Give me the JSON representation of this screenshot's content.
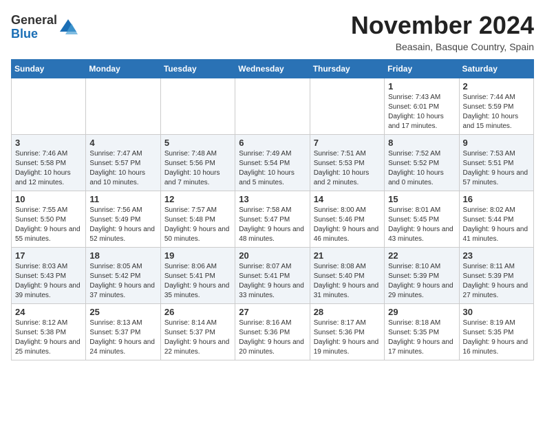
{
  "logo": {
    "line1": "General",
    "line2": "Blue"
  },
  "title": "November 2024",
  "location": "Beasain, Basque Country, Spain",
  "weekdays": [
    "Sunday",
    "Monday",
    "Tuesday",
    "Wednesday",
    "Thursday",
    "Friday",
    "Saturday"
  ],
  "weeks": [
    [
      {
        "day": "",
        "info": ""
      },
      {
        "day": "",
        "info": ""
      },
      {
        "day": "",
        "info": ""
      },
      {
        "day": "",
        "info": ""
      },
      {
        "day": "",
        "info": ""
      },
      {
        "day": "1",
        "info": "Sunrise: 7:43 AM\nSunset: 6:01 PM\nDaylight: 10 hours and 17 minutes."
      },
      {
        "day": "2",
        "info": "Sunrise: 7:44 AM\nSunset: 5:59 PM\nDaylight: 10 hours and 15 minutes."
      }
    ],
    [
      {
        "day": "3",
        "info": "Sunrise: 7:46 AM\nSunset: 5:58 PM\nDaylight: 10 hours and 12 minutes."
      },
      {
        "day": "4",
        "info": "Sunrise: 7:47 AM\nSunset: 5:57 PM\nDaylight: 10 hours and 10 minutes."
      },
      {
        "day": "5",
        "info": "Sunrise: 7:48 AM\nSunset: 5:56 PM\nDaylight: 10 hours and 7 minutes."
      },
      {
        "day": "6",
        "info": "Sunrise: 7:49 AM\nSunset: 5:54 PM\nDaylight: 10 hours and 5 minutes."
      },
      {
        "day": "7",
        "info": "Sunrise: 7:51 AM\nSunset: 5:53 PM\nDaylight: 10 hours and 2 minutes."
      },
      {
        "day": "8",
        "info": "Sunrise: 7:52 AM\nSunset: 5:52 PM\nDaylight: 10 hours and 0 minutes."
      },
      {
        "day": "9",
        "info": "Sunrise: 7:53 AM\nSunset: 5:51 PM\nDaylight: 9 hours and 57 minutes."
      }
    ],
    [
      {
        "day": "10",
        "info": "Sunrise: 7:55 AM\nSunset: 5:50 PM\nDaylight: 9 hours and 55 minutes."
      },
      {
        "day": "11",
        "info": "Sunrise: 7:56 AM\nSunset: 5:49 PM\nDaylight: 9 hours and 52 minutes."
      },
      {
        "day": "12",
        "info": "Sunrise: 7:57 AM\nSunset: 5:48 PM\nDaylight: 9 hours and 50 minutes."
      },
      {
        "day": "13",
        "info": "Sunrise: 7:58 AM\nSunset: 5:47 PM\nDaylight: 9 hours and 48 minutes."
      },
      {
        "day": "14",
        "info": "Sunrise: 8:00 AM\nSunset: 5:46 PM\nDaylight: 9 hours and 46 minutes."
      },
      {
        "day": "15",
        "info": "Sunrise: 8:01 AM\nSunset: 5:45 PM\nDaylight: 9 hours and 43 minutes."
      },
      {
        "day": "16",
        "info": "Sunrise: 8:02 AM\nSunset: 5:44 PM\nDaylight: 9 hours and 41 minutes."
      }
    ],
    [
      {
        "day": "17",
        "info": "Sunrise: 8:03 AM\nSunset: 5:43 PM\nDaylight: 9 hours and 39 minutes."
      },
      {
        "day": "18",
        "info": "Sunrise: 8:05 AM\nSunset: 5:42 PM\nDaylight: 9 hours and 37 minutes."
      },
      {
        "day": "19",
        "info": "Sunrise: 8:06 AM\nSunset: 5:41 PM\nDaylight: 9 hours and 35 minutes."
      },
      {
        "day": "20",
        "info": "Sunrise: 8:07 AM\nSunset: 5:41 PM\nDaylight: 9 hours and 33 minutes."
      },
      {
        "day": "21",
        "info": "Sunrise: 8:08 AM\nSunset: 5:40 PM\nDaylight: 9 hours and 31 minutes."
      },
      {
        "day": "22",
        "info": "Sunrise: 8:10 AM\nSunset: 5:39 PM\nDaylight: 9 hours and 29 minutes."
      },
      {
        "day": "23",
        "info": "Sunrise: 8:11 AM\nSunset: 5:39 PM\nDaylight: 9 hours and 27 minutes."
      }
    ],
    [
      {
        "day": "24",
        "info": "Sunrise: 8:12 AM\nSunset: 5:38 PM\nDaylight: 9 hours and 25 minutes."
      },
      {
        "day": "25",
        "info": "Sunrise: 8:13 AM\nSunset: 5:37 PM\nDaylight: 9 hours and 24 minutes."
      },
      {
        "day": "26",
        "info": "Sunrise: 8:14 AM\nSunset: 5:37 PM\nDaylight: 9 hours and 22 minutes."
      },
      {
        "day": "27",
        "info": "Sunrise: 8:16 AM\nSunset: 5:36 PM\nDaylight: 9 hours and 20 minutes."
      },
      {
        "day": "28",
        "info": "Sunrise: 8:17 AM\nSunset: 5:36 PM\nDaylight: 9 hours and 19 minutes."
      },
      {
        "day": "29",
        "info": "Sunrise: 8:18 AM\nSunset: 5:35 PM\nDaylight: 9 hours and 17 minutes."
      },
      {
        "day": "30",
        "info": "Sunrise: 8:19 AM\nSunset: 5:35 PM\nDaylight: 9 hours and 16 minutes."
      }
    ]
  ]
}
